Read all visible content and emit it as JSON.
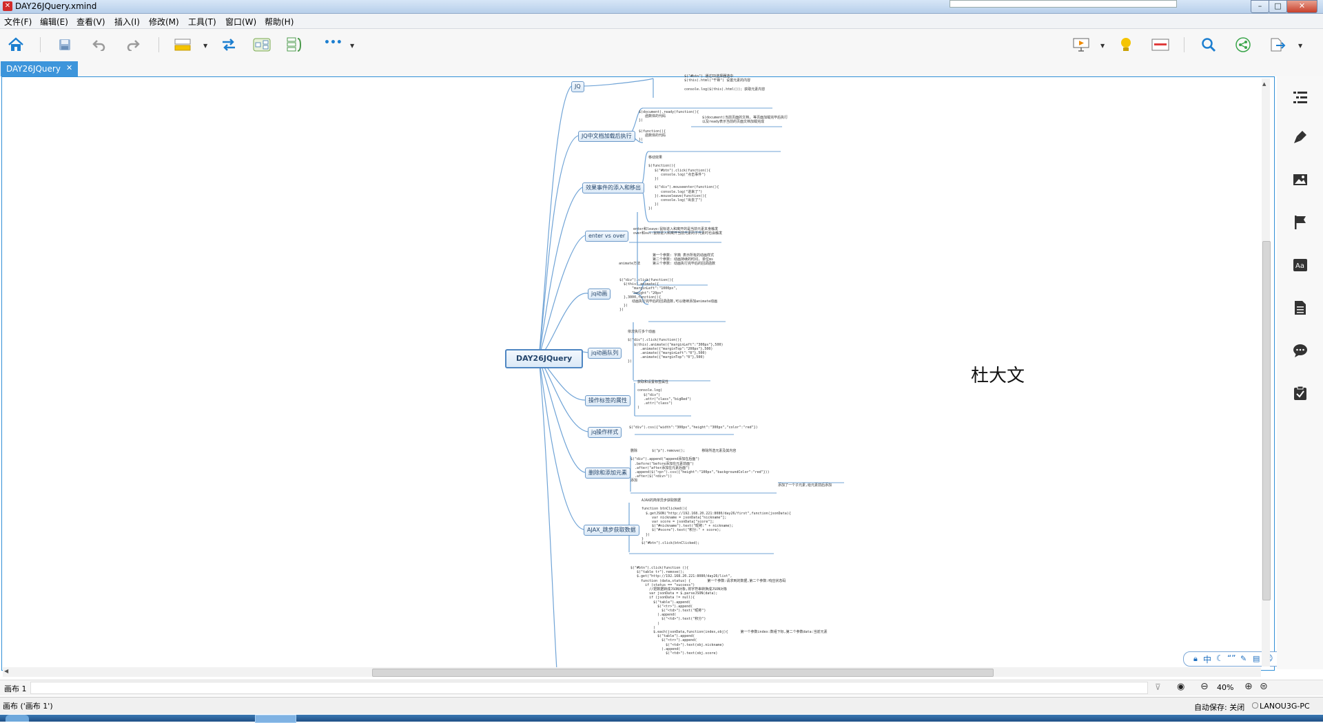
{
  "window": {
    "title": "DAY26JQuery.xmind",
    "controls": {
      "minimize": "–",
      "maximize": "□",
      "close": "✕"
    }
  },
  "menu": [
    "文件(F)",
    "编辑(E)",
    "查看(V)",
    "插入(I)",
    "修改(M)",
    "工具(T)",
    "窗口(W)",
    "帮助(H)"
  ],
  "toolbar": {
    "left_icons": [
      "home-icon",
      "save-icon",
      "undo-icon",
      "redo-icon",
      "topic-icon",
      "relationship-icon",
      "boundary-icon",
      "summary-icon",
      "more-icon"
    ],
    "right_icons": [
      "presentation-icon",
      "lightbulb-icon",
      "layout-icon",
      "search-icon",
      "share-icon",
      "export-icon"
    ],
    "more_label": "•••"
  },
  "tabs": [
    {
      "label": "DAY26JQuery",
      "close": "✕"
    }
  ],
  "mindmap": {
    "root": "DAY26JQuery",
    "floating_text": "杜大文",
    "branches": [
      {
        "label": "JQ"
      },
      {
        "label": "JQ中文档加载后执行"
      },
      {
        "label": "效果事件的添入和移出"
      },
      {
        "label": "enter vs over"
      },
      {
        "label": "jq动画"
      },
      {
        "label": "jq动画队列"
      },
      {
        "label": "操作标签的属性"
      },
      {
        "label": "jq操作样式"
      },
      {
        "label": "删除和添加元素"
      },
      {
        "label": "AJAX_跳步获取数据"
      }
    ],
    "notes": [
      "$(\"#btn\") 通过ID选择器选中\n$(this).html(\"千锋\") 设置元素的内容\n\nconsole.log($(this).html()); 获取元素内容",
      "$(document).ready(function(){\n   函数体的代码\n})",
      "$(document)当前页面的文档, 等页面加载完毕后执行\n以及ready表示当前的页面文档加载完成",
      "$(function(){\n   函数体的代码\n})",
      "移动效果\n\n$(function(){\n   $(\"#btn\").click(function(){\n      console.log(\"点击事件\")\n   })\n\n   $(\"div\").mouseenter(function(){\n      console.log(\"进来了\")\n   }).mouseleave(function(){\n      console.log(\"出去了\")\n   })\n})",
      "enter和leave:鼠标进入和离开的是当前元素本身触发\nover和out:鼠标进入和离开当前元素的子元素时也会触发",
      "animate方法",
      "第一个参数: 字典 表示所有的动画样式\n第二个参数: 动画持续的时间, 单位ms\n第三个参数: 动画执行完毕后的回调函数",
      "$(\"div\").click(function(){\n  $(this).animate({\n      \"marginLeft\":\"1000px\",\n      \"height\":\"20px\"\n  },3000,function(){\n      动画执行完毕后的回调函数,可以继续添加animate动画\n  })\n})",
      "依次执行多个动画\n\n$(\"div\").click(function(){\n   $(this).animate({\"marginLeft\":\"300px\"},500)\n      .animate({\"marginTop\":\"200px\"},500)\n      .animate({\"marginLeft\":\"0\"},500)\n      .animate({\"marginTop\":\"0\"},500)\n})",
      "获取和设置标签属性\n\nconsole.log(\n   $(\"div\")\n   .attr(\"class\",\"bigRed\")\n   .attr(\"class\")\n)",
      "$(\"div\").css({\"width\":\"300px\",\"height\":\"300px\",\"color\":\"red\"})",
      "删除       $(\"p\").remove();        移除所选元素及其内容\n\n$(\"div\").append(\"append添加在后面\")\n  .before(\"before添加在元素前面\")\n  .after(\"after添加在元素后面\")\n  .append($(\"<p>\").css({\"height\":\"100px\",\"backgroundColor\":\"red\"}))\n  .after($(\"<div>\"))\n添加",
      "添加了一个子元素,给元素前后添加",
      "AJAX的简单异步获取数据\n\nfunction btnClicked(){\n  $.getJSON(\"http://192.168.20.221:8080/day26/first\",function(jsonData){\n     var nickname = jsonData[\"nickname\"];\n     var score = jsonData[\"score\"];\n     $(\"#nickname\").text(\"昵称:\" + nickname);\n     $(\"#score\").text(\"积分:\" + score);\n  })\n}\n$(\"#btn\").click(btnClicked);",
      "$(\"#btn\").click(function (){\n   $(\"table tr\").remove();\n   $.get(\"http://192.168.20.221:8080/day26/list\",\n     function (data,status) {        第一个参数:请求到的数据,第二个参数:响应状态码\n       if (status == \"success\")\n         //把数据转成JSON对象,将字符串转换成JSON对象\n         var jsonData = $.parseJSON(data);\n         if (jsonData != null){\n           $(\"table\").append(\n             $(\"<tr>\").append(\n               $(\"<td>\").text(\"昵称\")\n             ).append(\n               $(\"<td>\").text(\"积分\")\n             )\n           )\n           $.each(jsonData,function(index,obj){      第一个参数index:数组下标,第二个参数data:当前元素\n             $(\"table\").append(\n               $(\"<tr>\").append(\n                 $(\"<td>\").text(obj.nickname)\n               ).append(\n                 $(\"<td>\").text(obj.score)"
    ]
  },
  "sheet": {
    "label": "画布 1",
    "zoom": "40%"
  },
  "status": {
    "left": "画布 ('画布 1')",
    "autosave": "自动保存: 关闭",
    "computer": "LANOU3G-PC"
  },
  "ime": [
    "中",
    "☾",
    "“”"
  ]
}
